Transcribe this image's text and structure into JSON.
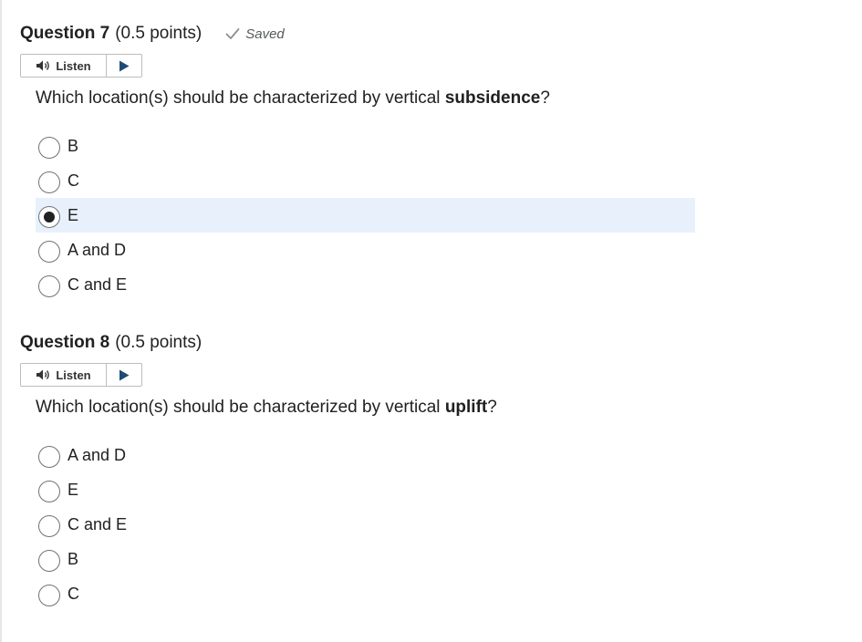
{
  "questions": [
    {
      "title": "Question 7",
      "points": "(0.5 points)",
      "saved": "Saved",
      "listen_label": "Listen",
      "text_before": "Which location(s) should be characterized by vertical ",
      "text_bold": "subsidence",
      "text_after": "?",
      "options": [
        {
          "label": "B",
          "selected": false
        },
        {
          "label": "C",
          "selected": false
        },
        {
          "label": "E",
          "selected": true
        },
        {
          "label": "A and D",
          "selected": false
        },
        {
          "label": "C and E",
          "selected": false
        }
      ]
    },
    {
      "title": "Question 8",
      "points": "(0.5 points)",
      "listen_label": "Listen",
      "text_before": "Which location(s) should be characterized by vertical ",
      "text_bold": "uplift",
      "text_after": "?",
      "options": [
        {
          "label": "A and D",
          "selected": false
        },
        {
          "label": "E",
          "selected": false
        },
        {
          "label": "C and E",
          "selected": false
        },
        {
          "label": "B",
          "selected": false
        },
        {
          "label": "C",
          "selected": false
        }
      ]
    }
  ],
  "icons": {
    "saved": "checkmark-icon",
    "listen": "speaker-icon",
    "play": "play-icon"
  },
  "colors": {
    "selected_row": "#e8f1fb",
    "text": "#202122",
    "muted": "#565a5c"
  }
}
